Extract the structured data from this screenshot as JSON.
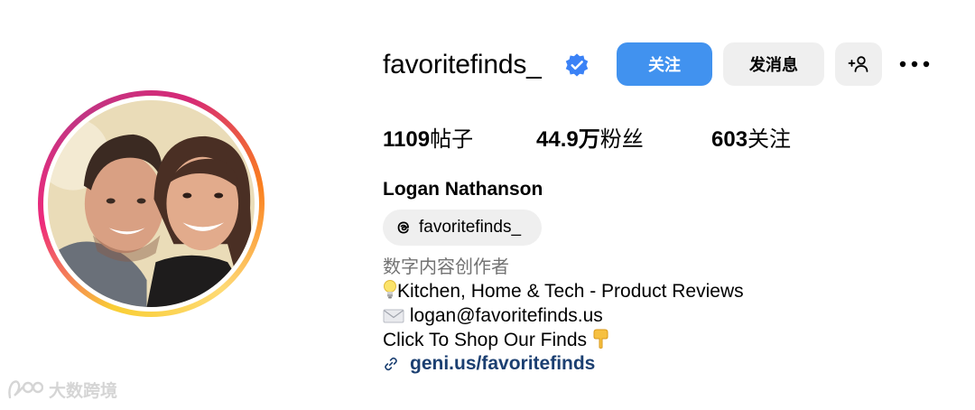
{
  "profile": {
    "username": "favoritefinds_",
    "verified": true,
    "full_name": "Logan Nathanson",
    "threads_handle": "favoritefinds_",
    "category": "数字内容创作者"
  },
  "actions": {
    "follow_label": "关注",
    "message_label": "发消息",
    "suggest_label": "+",
    "more_label": "•••"
  },
  "stats": {
    "posts_value": "1109",
    "posts_label": "帖子",
    "followers_value": "44.9万",
    "followers_label": "粉丝",
    "following_value": "603",
    "following_label": "关注"
  },
  "bio": {
    "line1_text": "Kitchen, Home & Tech - Product Reviews",
    "line2_text": "logan@favoritefinds.us",
    "line3_text": "Click To Shop Our Finds",
    "link_text": "geni.us/favoritefinds"
  },
  "watermark": {
    "text": "大数跨境"
  },
  "colors": {
    "follow_button": "#4192ef",
    "secondary_button": "#efefef",
    "verified_badge": "#3b82f6",
    "link": "#1b3f71",
    "category_text": "#737373"
  },
  "icons": {
    "verified": "verified-badge-icon",
    "threads": "threads-icon",
    "link": "link-icon",
    "suggest": "add-person-icon",
    "more": "more-dots-icon"
  }
}
